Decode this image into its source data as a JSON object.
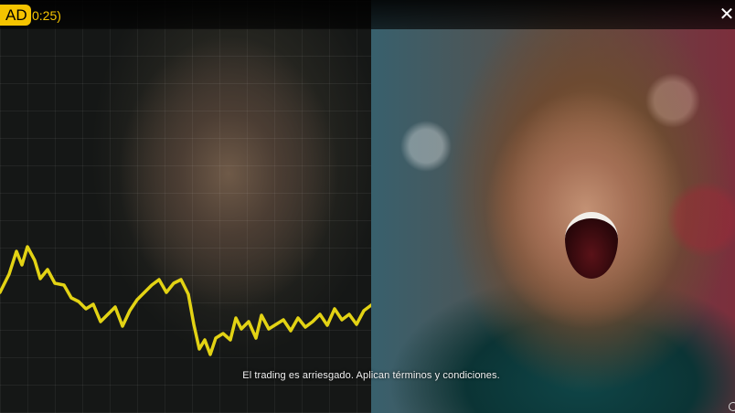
{
  "ad": {
    "badge_label": "AD",
    "timer": "0:25)",
    "close_symbol": "✕",
    "accent_color": "#f5c400"
  },
  "video": {
    "left_scene": "man-face-with-trading-chart",
    "right_scene": "cheering-man-in-crowd",
    "chart_line_color": "#e3d314",
    "disclaimer": "El trading es arriesgado. Aplican términos y condiciones."
  },
  "icons": {
    "close": "close-icon",
    "corner": "circle-icon"
  }
}
